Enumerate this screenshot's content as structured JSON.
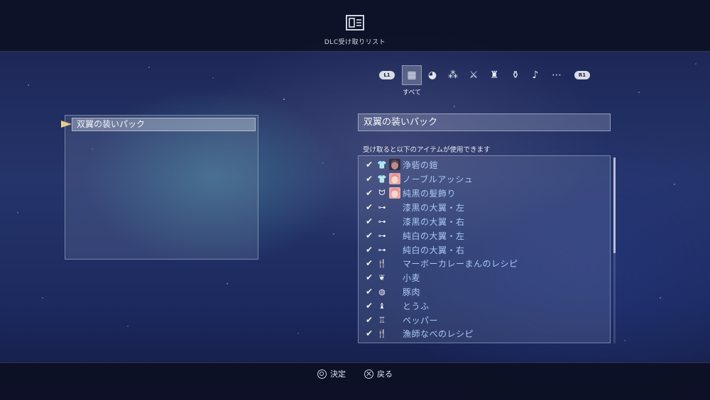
{
  "header": {
    "icon": "dlc-list-icon",
    "title": "DLC受け取りリスト"
  },
  "tabs": {
    "left_shoulder": "L1",
    "right_shoulder": "R1",
    "active_label": "すべて",
    "items": [
      {
        "icon": "grid-all-icon",
        "glyph": "▦",
        "active": true
      },
      {
        "icon": "food-icon",
        "glyph": "◕"
      },
      {
        "icon": "material-icon",
        "glyph": "⁂"
      },
      {
        "icon": "weapon-icon",
        "glyph": "⚔"
      },
      {
        "icon": "hat-icon",
        "glyph": "♜"
      },
      {
        "icon": "accessory-icon",
        "glyph": "⚱"
      },
      {
        "icon": "music-icon",
        "glyph": "♪"
      },
      {
        "icon": "more-icon",
        "glyph": "⋯"
      }
    ]
  },
  "packs": [
    {
      "label": "双翼の装いパック",
      "selected": true
    }
  ],
  "detail": {
    "title": "双翼の装いパック",
    "caption": "受け取ると以下のアイテムが使用できます",
    "items": [
      {
        "check": "✔",
        "icon": "costume-icon",
        "glyph": "👕",
        "portrait": "character-dark",
        "name": "浄砦の鎧"
      },
      {
        "check": "✔",
        "icon": "costume-icon",
        "glyph": "👕",
        "portrait": "character-pink",
        "name": "ノーブルアッシュ"
      },
      {
        "check": "✔",
        "icon": "hair-accessory-icon",
        "glyph": "ᗢ",
        "portrait": "character-pink",
        "name": "純黒の髪飾り"
      },
      {
        "check": "✔",
        "icon": "glasses-icon",
        "glyph": "⊶",
        "portrait": "",
        "name": "漆黒の大翼・左"
      },
      {
        "check": "✔",
        "icon": "glasses-icon",
        "glyph": "⊶",
        "portrait": "",
        "name": "漆黒の大翼・右"
      },
      {
        "check": "✔",
        "icon": "glasses-icon",
        "glyph": "⊶",
        "portrait": "",
        "name": "純白の大翼・左"
      },
      {
        "check": "✔",
        "icon": "glasses-icon",
        "glyph": "⊶",
        "portrait": "",
        "name": "純白の大翼・右"
      },
      {
        "check": "✔",
        "icon": "recipe-icon",
        "glyph": "🍴",
        "portrait": "",
        "name": "マーボーカレーまんのレシピ"
      },
      {
        "check": "✔",
        "icon": "wheat-icon",
        "glyph": "❦",
        "portrait": "",
        "name": "小麦"
      },
      {
        "check": "✔",
        "icon": "meat-icon",
        "glyph": "◍",
        "portrait": "",
        "name": "豚肉"
      },
      {
        "check": "✔",
        "icon": "tofu-icon",
        "glyph": "♝",
        "portrait": "",
        "name": "とうふ"
      },
      {
        "check": "✔",
        "icon": "pepper-icon",
        "glyph": "♖",
        "portrait": "",
        "name": "ペッパー"
      },
      {
        "check": "✔",
        "icon": "recipe-icon",
        "glyph": "🍴",
        "portrait": "",
        "name": "漁師なべのレシピ"
      }
    ]
  },
  "footer": {
    "confirm": {
      "icon": "circle-button-icon",
      "label": "決定"
    },
    "back": {
      "icon": "cross-button-icon",
      "label": "戻る"
    }
  },
  "colors": {
    "item_text": "#a9c8f4",
    "cursor": "#e7cf8b",
    "check": "#eaf3e2"
  }
}
